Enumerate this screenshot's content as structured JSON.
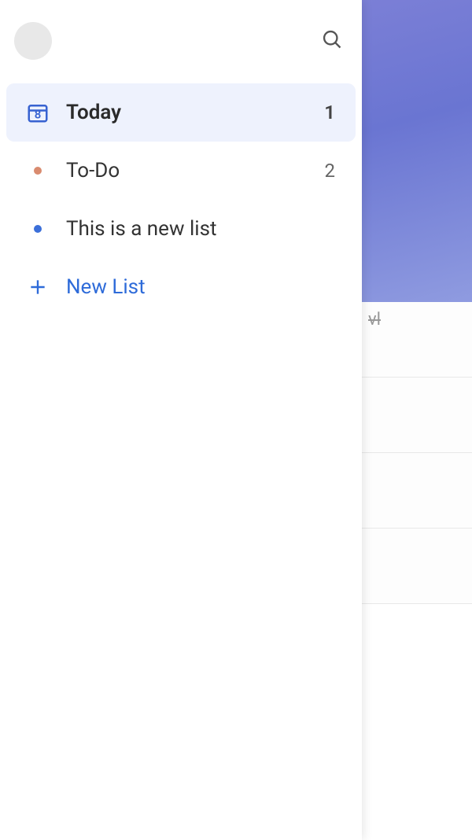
{
  "sidebar": {
    "items": [
      {
        "label": "Today",
        "count": "1",
        "icon": "today",
        "active": true,
        "day_number": "8"
      },
      {
        "label": "To-Do",
        "count": "2",
        "icon": "bullet-orange",
        "active": false
      },
      {
        "label": "This is a new list",
        "count": "",
        "icon": "bullet-blue",
        "active": false
      }
    ],
    "new_list_label": "New List"
  },
  "background": {
    "task_fragment": "vl"
  }
}
